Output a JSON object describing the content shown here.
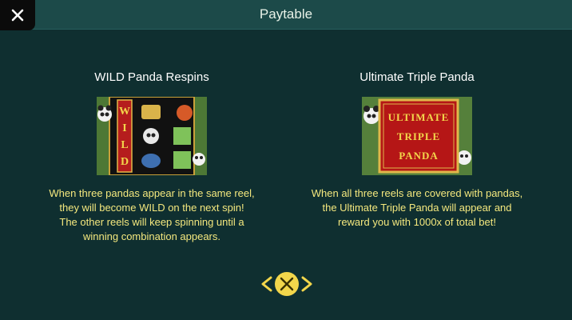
{
  "header": {
    "title": "Paytable",
    "close_icon": "close-icon"
  },
  "features": [
    {
      "title": "WILD Panda Respins",
      "image_letters": [
        "W",
        "I",
        "L",
        "D"
      ],
      "description_lines": [
        "When three pandas appear in the same reel,",
        "they will become WILD on the next spin!",
        "The other reels will keep spinning until a",
        "winning combination appears."
      ]
    },
    {
      "title": "Ultimate Triple Panda",
      "image_lines": [
        "Ultimate",
        "Triple",
        "Panda"
      ],
      "description_lines": [
        "When all three reels are covered with pandas,",
        "the Ultimate Triple Panda will appear and",
        "reward you with 1000x of total bet!"
      ]
    }
  ],
  "navigation": {
    "prev_icon": "chevron-left-icon",
    "close_icon": "close-icon",
    "next_icon": "chevron-right-icon"
  },
  "colors": {
    "background": "#0f2f30",
    "header": "#1c4a49",
    "description_text": "#f4e87e",
    "nav_gold": "#f2d64b"
  }
}
